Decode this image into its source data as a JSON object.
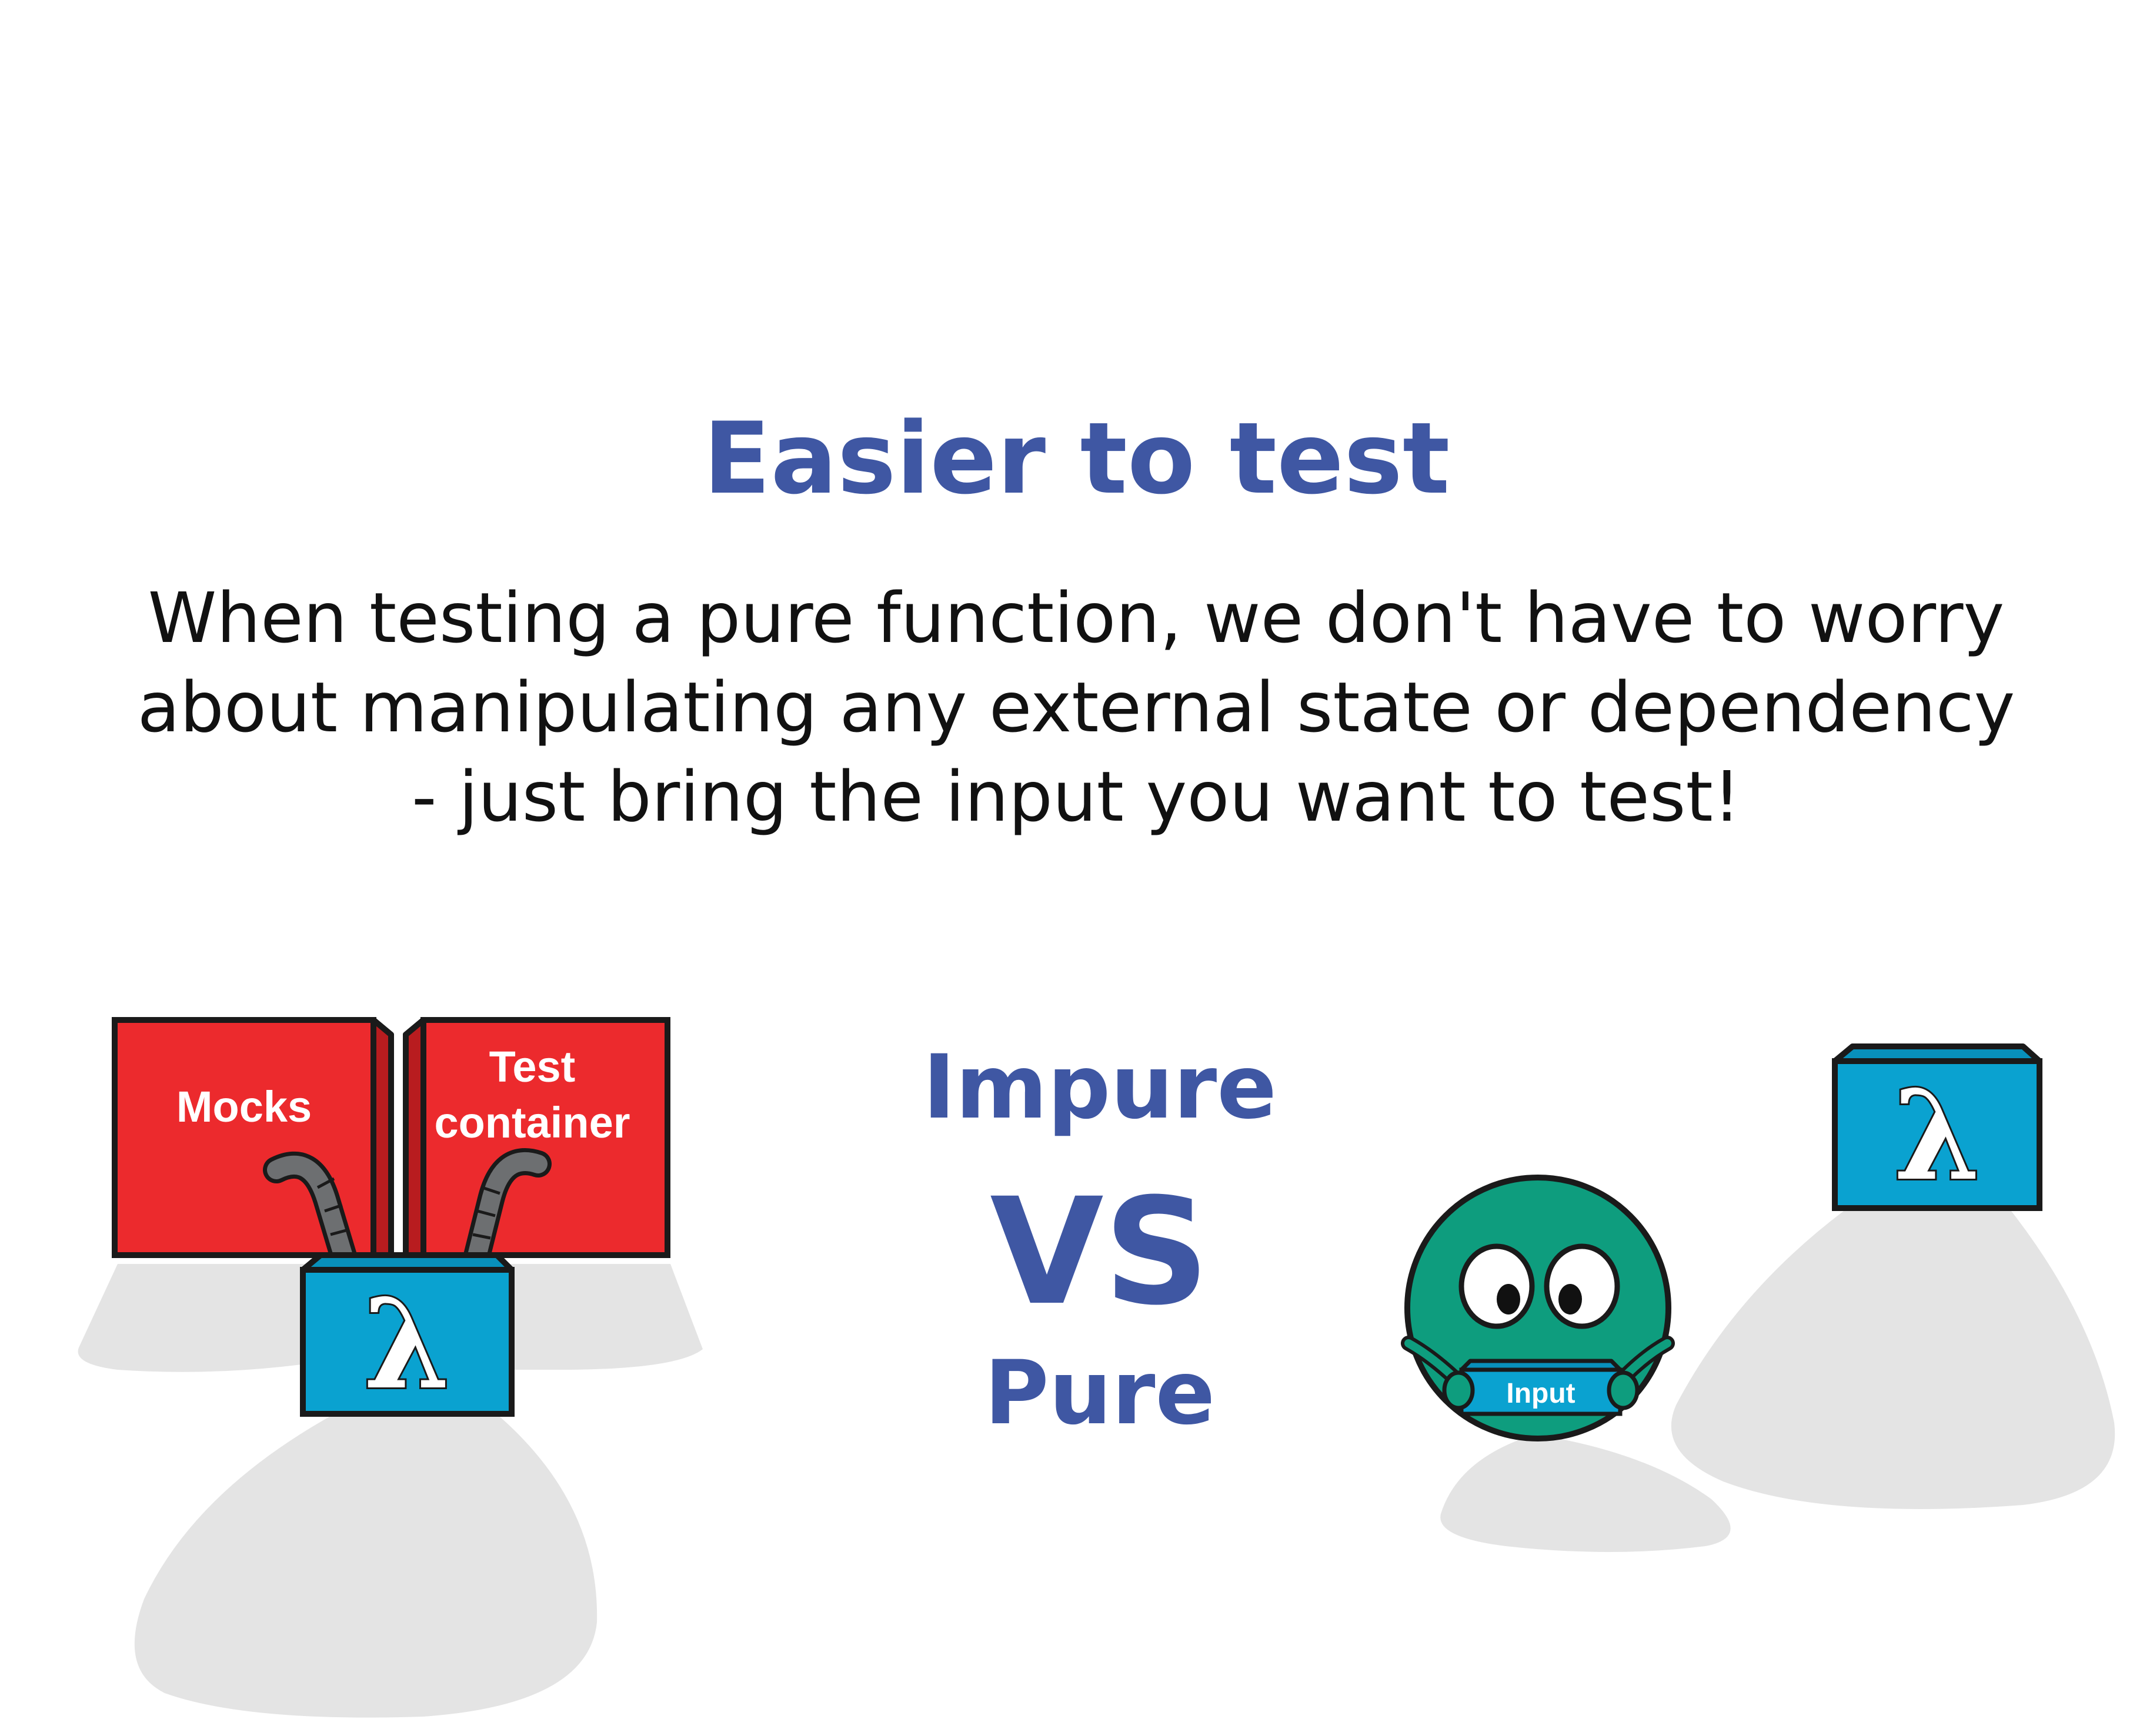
{
  "header": {
    "title": "Easier to test"
  },
  "description": {
    "lines": [
      "When testing a pure function, we don't have to worry",
      "about manipulating any external state or dependency",
      "- just bring the input you want to test!"
    ]
  },
  "comparison": {
    "left_label": "Impure",
    "middle_label": "VS",
    "right_label": "Pure"
  },
  "impure_side": {
    "mocks_label": "Mocks",
    "test_container_line1": "Test",
    "test_container_line2": "container",
    "function_symbol": "λ",
    "icon": "lambda-box-icon"
  },
  "pure_side": {
    "input_label": "Input",
    "function_symbol": "λ",
    "icon": "lambda-box-icon",
    "character_icon": "green-ball-character-icon"
  },
  "colors": {
    "title_blue": "#3f57a3",
    "text_black": "#111111",
    "dependency_red": "#ec2a2d",
    "lambda_box_blue": "#0aa2d0",
    "character_green": "#0e9d7e",
    "shadow_gray": "#e4e4e4",
    "cable_gray": "#6d6f71"
  }
}
